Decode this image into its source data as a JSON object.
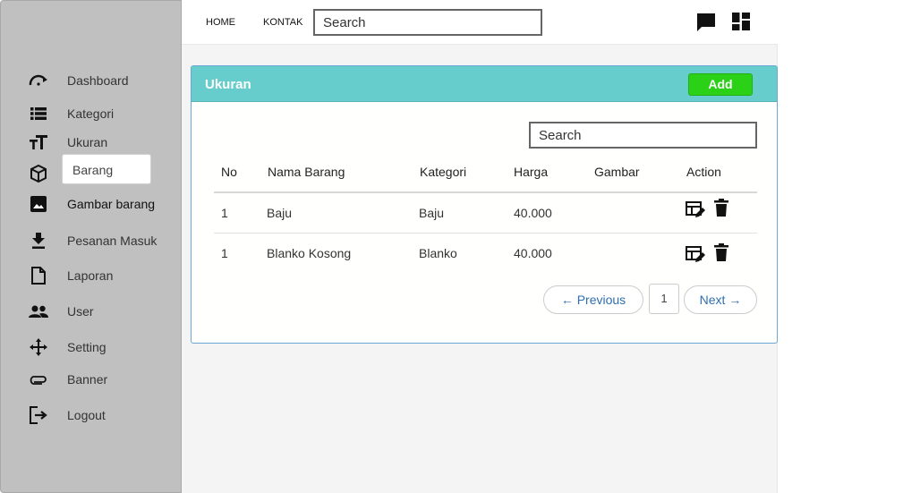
{
  "sidebar": {
    "items": [
      {
        "label": "Dashboard",
        "icon": "speedometer-icon"
      },
      {
        "label": "Kategori",
        "icon": "list-icon"
      },
      {
        "label": "Ukuran",
        "icon": "text-size-icon"
      },
      {
        "label": "Barang",
        "icon": "box-icon"
      },
      {
        "label": "Gambar barang",
        "icon": "image-icon"
      },
      {
        "label": "Pesanan Masuk",
        "icon": "download-icon"
      },
      {
        "label": "Laporan",
        "icon": "file-icon"
      },
      {
        "label": "User",
        "icon": "people-icon"
      },
      {
        "label": "Setting",
        "icon": "move-icon"
      },
      {
        "label": "Banner",
        "icon": "paperclip-icon"
      },
      {
        "label": "Logout",
        "icon": "logout-icon"
      }
    ],
    "submenu": {
      "label": "Barang"
    }
  },
  "topbar": {
    "home": "HOME",
    "kontak": "KONTAK",
    "search_value": "Search",
    "icons": [
      "chat-icon",
      "dashboard-icon"
    ]
  },
  "card": {
    "title": "Ukuran",
    "add_label": "Add",
    "search_value": "Search",
    "columns": [
      "No",
      "Nama Barang",
      "Kategori",
      "Harga",
      "Gambar",
      "Action"
    ],
    "rows": [
      {
        "no": "1",
        "nama": "Baju",
        "kategori": "Baju",
        "harga": "40.000",
        "gambar": ""
      },
      {
        "no": "1",
        "nama": "Blanko Kosong",
        "kategori": "Blanko",
        "harga": "40.000",
        "gambar": ""
      }
    ],
    "pagination": {
      "previous": "← Previous",
      "page": "1",
      "next": "Next →"
    }
  },
  "colors": {
    "sidebar_bg": "#c0c0c0",
    "card_header": "#66cccc",
    "add_button": "#2ad117",
    "link": "#2f6fb0"
  }
}
